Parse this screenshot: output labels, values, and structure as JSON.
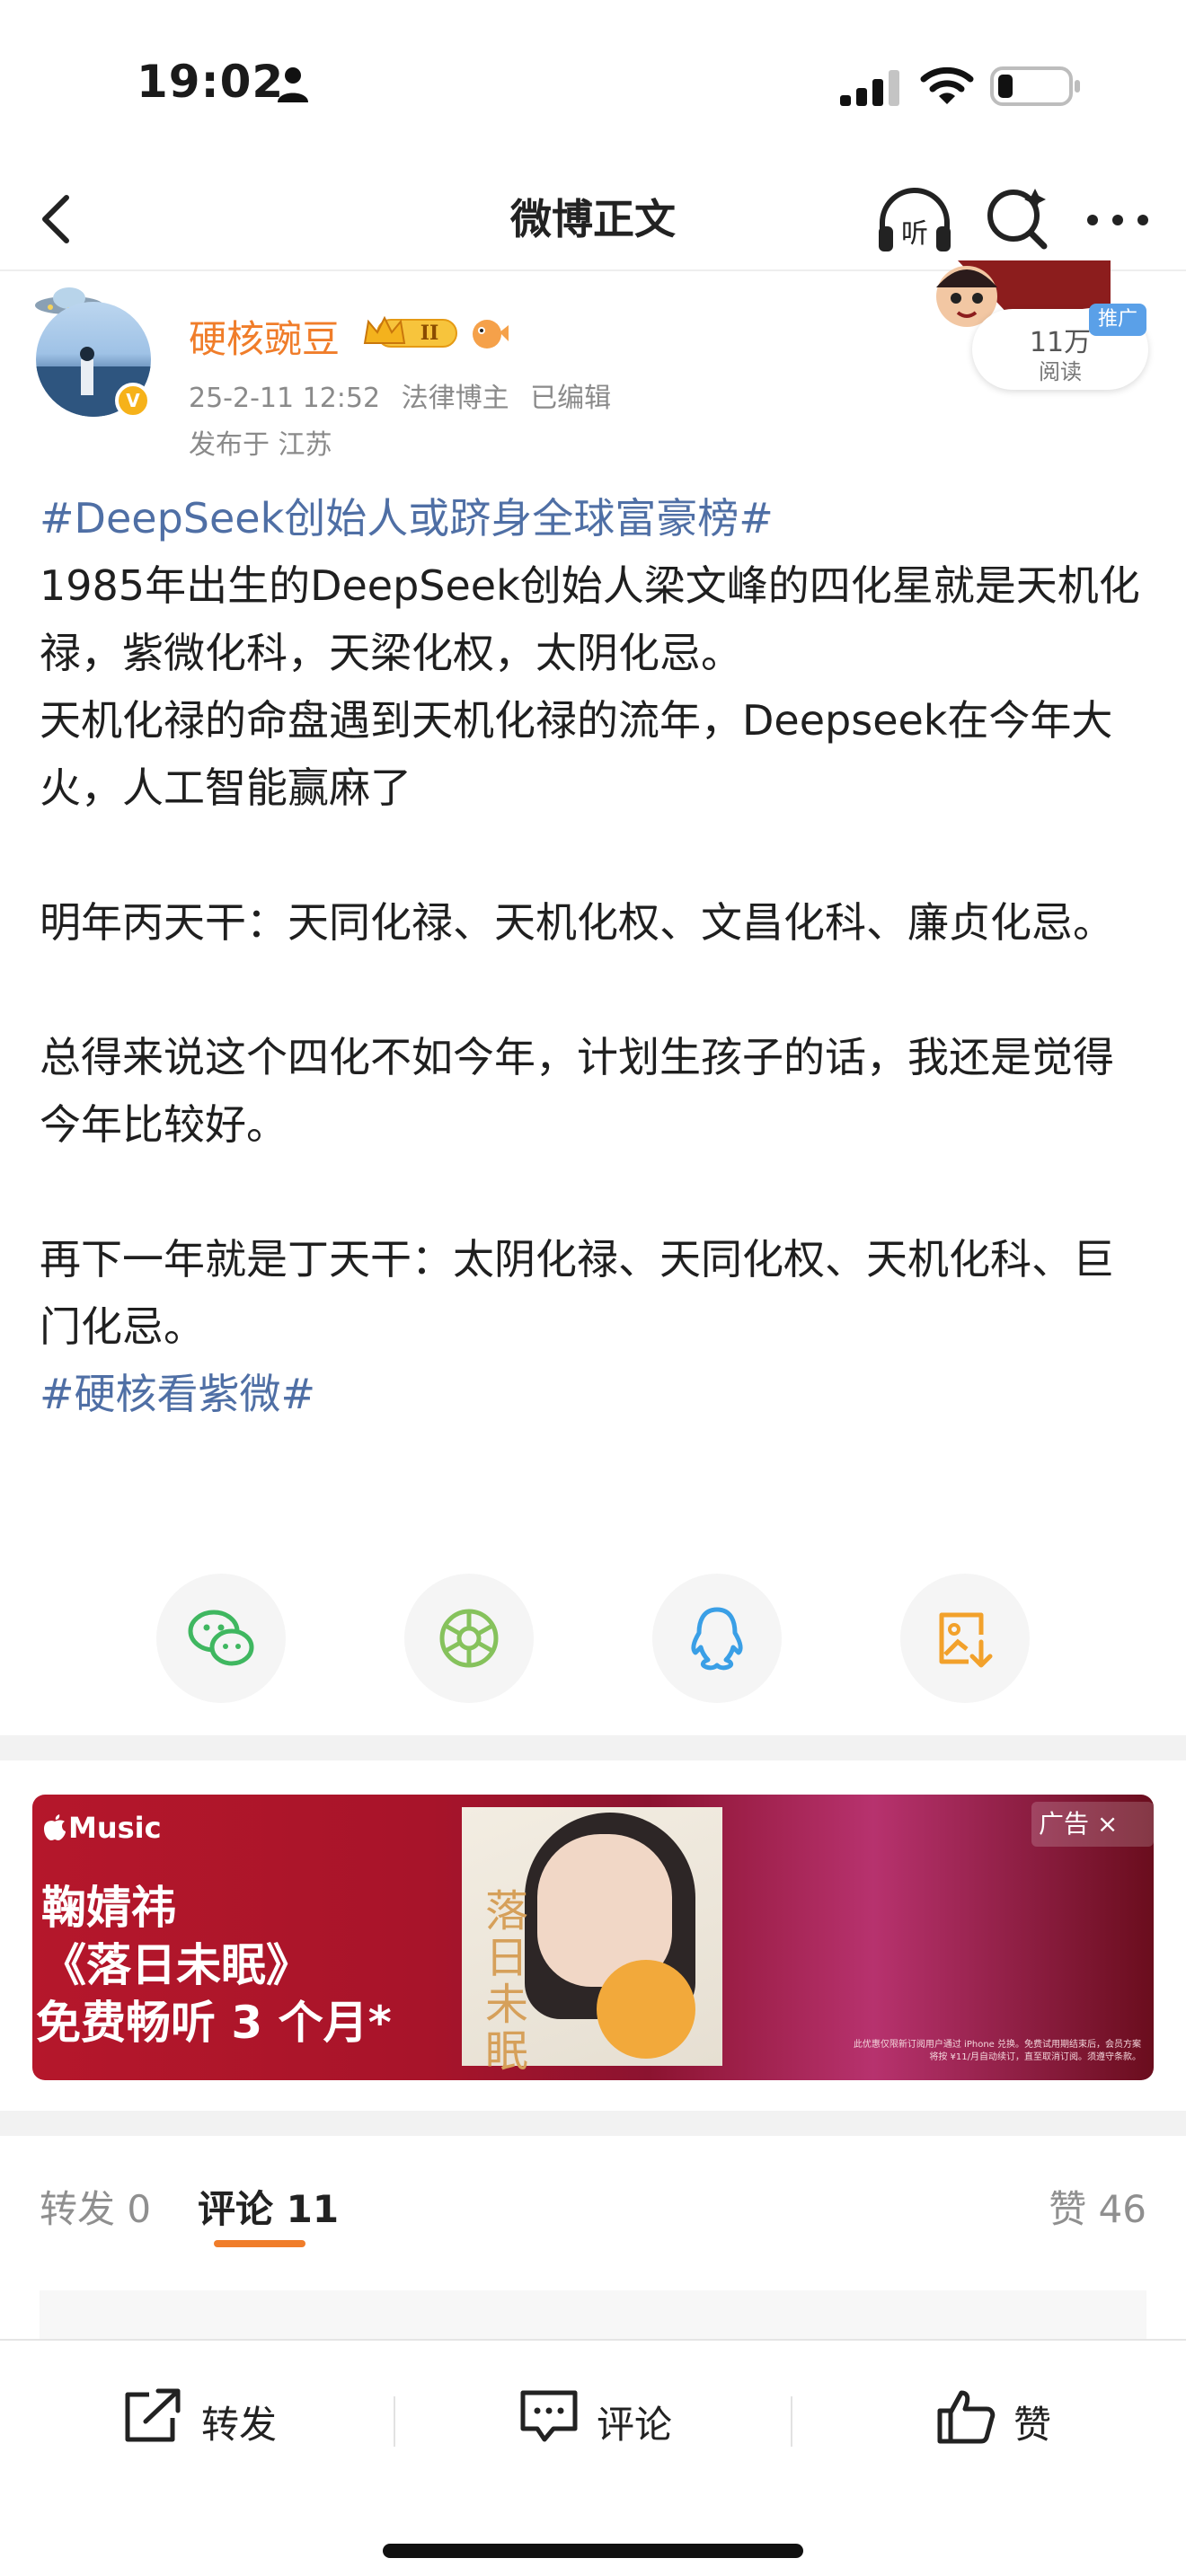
{
  "status_bar": {
    "time": "19:02"
  },
  "nav": {
    "title": "微博正文"
  },
  "author": {
    "name": "硬核豌豆",
    "vip_level": "II",
    "date": "25-2-11 12:52",
    "role": "法律博主",
    "edited": "已编辑",
    "location": "发布于 江苏",
    "read_count": "11万",
    "read_label": "阅读",
    "promo_tag": "推广"
  },
  "post": {
    "paragraphs": [
      {
        "type": "topic",
        "text": "#DeepSeek创始人或跻身全球富豪榜#"
      },
      {
        "type": "text",
        "text": "1985年出生的DeepSeek创始人梁文峰的四化星就是天机化禄，紫微化科，天梁化权，太阴化忌。"
      },
      {
        "type": "text",
        "text": "天机化禄的命盘遇到天机化禄的流年，Deepseek在今年大火，人工智能赢麻了"
      },
      {
        "type": "blank",
        "text": ""
      },
      {
        "type": "text",
        "text": "明年丙天干：天同化禄、天机化权、文昌化科、廉贞化忌。"
      },
      {
        "type": "blank",
        "text": ""
      },
      {
        "type": "text",
        "text": "总得来说这个四化不如今年，计划生孩子的话，我还是觉得今年比较好。"
      },
      {
        "type": "blank",
        "text": ""
      },
      {
        "type": "text",
        "text": "再下一年就是丁天干：太阴化禄、天同化权、天机化科、巨门化忌。"
      },
      {
        "type": "topic",
        "text": "#硬核看紫微#"
      }
    ]
  },
  "share": {
    "items": [
      {
        "name": "wechat",
        "icon": "wechat-icon"
      },
      {
        "name": "moments",
        "icon": "moments-icon"
      },
      {
        "name": "qq",
        "icon": "qq-icon"
      },
      {
        "name": "save-image",
        "icon": "save-image-icon"
      }
    ]
  },
  "ad": {
    "brand": "Music",
    "artist": "鞠婧祎",
    "album": "《落日未眠》",
    "offer": "免费畅听 3 个月*",
    "cover_title": "落日未眠",
    "label": "广告 ×",
    "fine_print": "此优惠仅限新订阅用户通过 iPhone 兑换。免费试用期结束后，会员方案将按 ¥11/月自动续订，直至取消订阅。须遵守条款。"
  },
  "tabs": {
    "repost": "转发 0",
    "comment": "评论 11",
    "like": "赞 46"
  },
  "bottom_bar": {
    "repost": "转发",
    "comment": "评论",
    "like": "赞"
  },
  "colors": {
    "accent": "#f07d2a",
    "topic": "#4f6fa5",
    "ad_red": "#b5172b"
  }
}
